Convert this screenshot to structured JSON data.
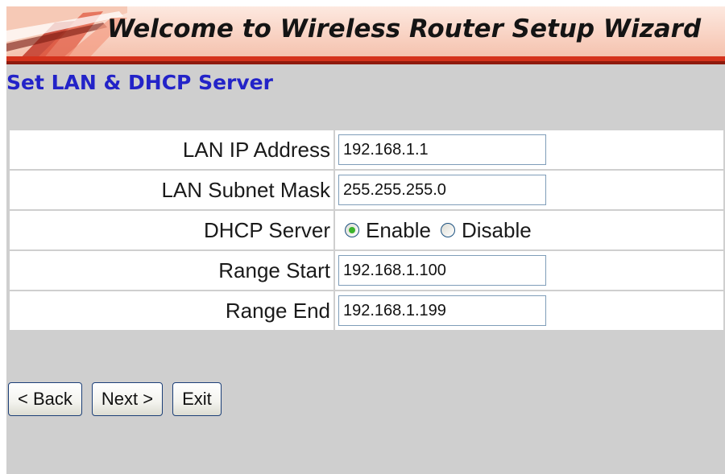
{
  "banner": {
    "title": "Welcome to Wireless Router Setup Wizard"
  },
  "page": {
    "title": "Set LAN & DHCP Server"
  },
  "form": {
    "lan_ip": {
      "label": "LAN IP Address",
      "value": "192.168.1.1"
    },
    "subnet_mask": {
      "label": "LAN Subnet Mask",
      "value": "255.255.255.0"
    },
    "dhcp_server": {
      "label": "DHCP Server",
      "options": [
        {
          "label": "Enable",
          "checked": true
        },
        {
          "label": "Disable",
          "checked": false
        }
      ]
    },
    "range_start": {
      "label": "Range Start",
      "value": "192.168.1.100"
    },
    "range_end": {
      "label": "Range End",
      "value": "192.168.1.199"
    }
  },
  "buttons": {
    "back": "< Back",
    "next": "Next >",
    "exit": "Exit"
  },
  "colors": {
    "page_title": "#2323c8",
    "content_background": "#cfcfcf",
    "banner_red": "#d4321c",
    "radio_checked": "#3cb42c"
  }
}
